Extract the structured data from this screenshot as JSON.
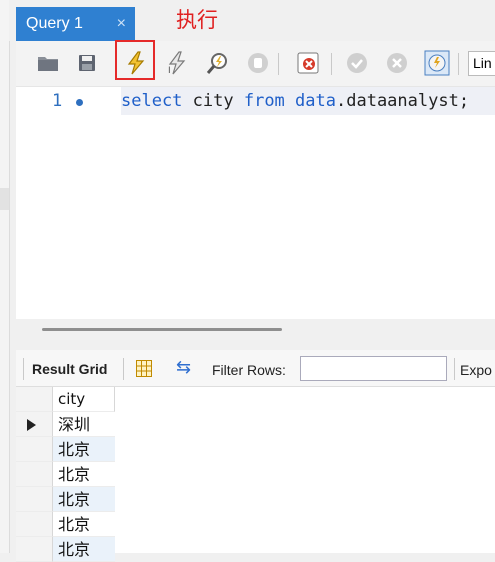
{
  "tab": {
    "title": "Query 1",
    "close": "×"
  },
  "annotation": "执行",
  "toolbar": {
    "icons": [
      "folder-icon",
      "save-icon",
      "execute-icon",
      "execute-current-icon",
      "explain-icon",
      "stop-icon",
      "toggle-error-icon",
      "commit-icon",
      "rollback-icon",
      "autocommit-icon"
    ],
    "limit_label": "Lin"
  },
  "editor": {
    "line_number": "1",
    "code": {
      "kw1": "select",
      "t1": " city ",
      "kw2": "from",
      "t2": " ",
      "kw3": "data",
      "t3": ".dataanalyst;"
    }
  },
  "results": {
    "result_grid_label": "Result Grid",
    "filter_label": "Filter Rows:",
    "filter_value": "",
    "export_label": "Expo",
    "column": "city",
    "rows": [
      "深圳",
      "北京",
      "北京",
      "北京",
      "北京",
      "北京"
    ]
  },
  "colors": {
    "tab": "#2f80d1",
    "annotation": "#e02020",
    "keyword": "#1f5fc9",
    "alt_row": "#eaf2fa"
  }
}
